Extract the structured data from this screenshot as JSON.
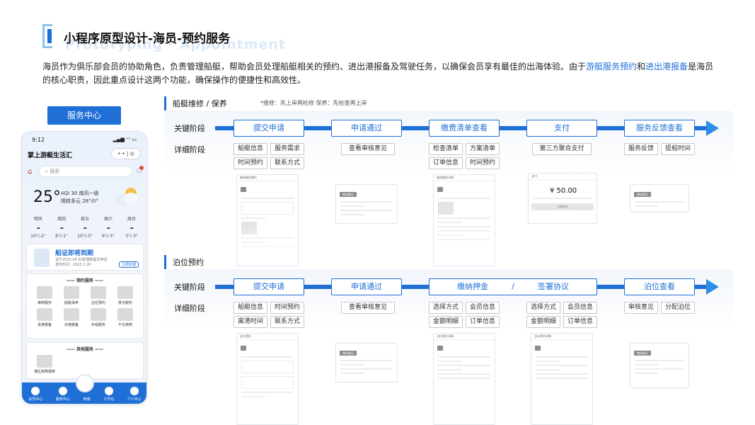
{
  "header": {
    "title": "小程序原型设计-海员-预约服务",
    "title_shadow": "Prototyping · Appointment",
    "intro_part1": "海员作为俱乐部会员的协助角色，负责管理船艇，帮助会员处理船艇相关的预约、进出港报备及驾驶任务，以确保会员享有最佳的出海体验。由于",
    "intro_hl1": "游艇服务预约",
    "intro_and": "和",
    "intro_hl2": "进出港报备",
    "intro_part2": "是海员的核心职责，因此重点设计这两个功能，确保操作的便捷性和高效性。"
  },
  "service_center_label": "服务中心",
  "phone": {
    "time": "9:12",
    "signal": "▂▄▆ ◠ ▭",
    "app_title": "掌上游艇生活汇",
    "capsule": "•·•  |  ◎",
    "search_placeholder": "搜索",
    "temperature": "25°",
    "aqi": "AQI 30   南风一级",
    "weather": "晴转多云   28°/0°",
    "forecast": [
      {
        "day": "明天",
        "temp": "10°/-2°"
      },
      {
        "day": "周四",
        "temp": "9°/-1°"
      },
      {
        "day": "周五",
        "temp": "10°/-3°"
      },
      {
        "day": "周六",
        "temp": "6°/-3°"
      },
      {
        "day": "周日",
        "temp": "3°/-3°"
      }
    ],
    "notice_title": "船证即将到期",
    "notice_desc1": "请于2023.04.30前重新提交申请",
    "notice_desc2": "发布时间：2023.2.20",
    "notice_btn": "立即处理",
    "booking_title": "—— 预约服务 ——",
    "booking_items": [
      "维修服务",
      "船艇保养",
      "泊位预约",
      "排污服务",
      "进港报备",
      "出港报备",
      "补给服务",
      "干仓使用"
    ],
    "other_title": "—— 其他服务 ——",
    "other_items": [
      "港区故障报修"
    ],
    "tabs": [
      "会员中心",
      "服务中心",
      "商城",
      "工作台",
      "个人中心"
    ]
  },
  "section1": {
    "title": "船艇维修 / 保养",
    "note": "*维修：先上岸再检修    保养：先检查再上岸",
    "key_label": "关键阶段",
    "detail_label": "详细阶段",
    "stages": [
      "提交申请",
      "申请通过",
      "缴费清单查看",
      "支付",
      "服务反馈查看"
    ],
    "chips": [
      [
        "船艇信息",
        "服务需求",
        "时间预约",
        "联系方式"
      ],
      [
        "查看审核意见"
      ],
      [
        "检查清单",
        "方案清单",
        "订单信息",
        "时间预约"
      ],
      [
        "第三方聚合支付"
      ],
      [
        "服务反馈",
        "提船时间"
      ]
    ],
    "shots": [
      "维修服务预约",
      "审核意见",
      "维修服务详情",
      "支付",
      "审核意见"
    ],
    "pay_amount": "¥ 50.00",
    "pay_button": "立即支付"
  },
  "section2": {
    "title": "泊位预约",
    "key_label": "关键阶段",
    "detail_label": "详细阶段",
    "stages": [
      "提交申请",
      "申请通过",
      "缴纳押金",
      "签署协议",
      "泊位查看"
    ],
    "stage_sep": "/",
    "chips": [
      [
        "船艇信息",
        "时间预约",
        "离港时间",
        "联系方式"
      ],
      [
        "查看审核意见"
      ],
      [
        "选择方式",
        "会员信息",
        "金额明细",
        "订单信息"
      ],
      [
        "选择方式",
        "会员信息",
        "金额明细",
        "订单信息"
      ],
      [
        "审核意见",
        "分配泊位"
      ]
    ],
    "shots": [
      "泊位预约",
      "审核意见",
      "泊位预约详情",
      "泊位预约详情",
      "审核意见"
    ]
  },
  "colors": {
    "accent": "#1f6fd6",
    "arrow": "#2f8de6"
  }
}
